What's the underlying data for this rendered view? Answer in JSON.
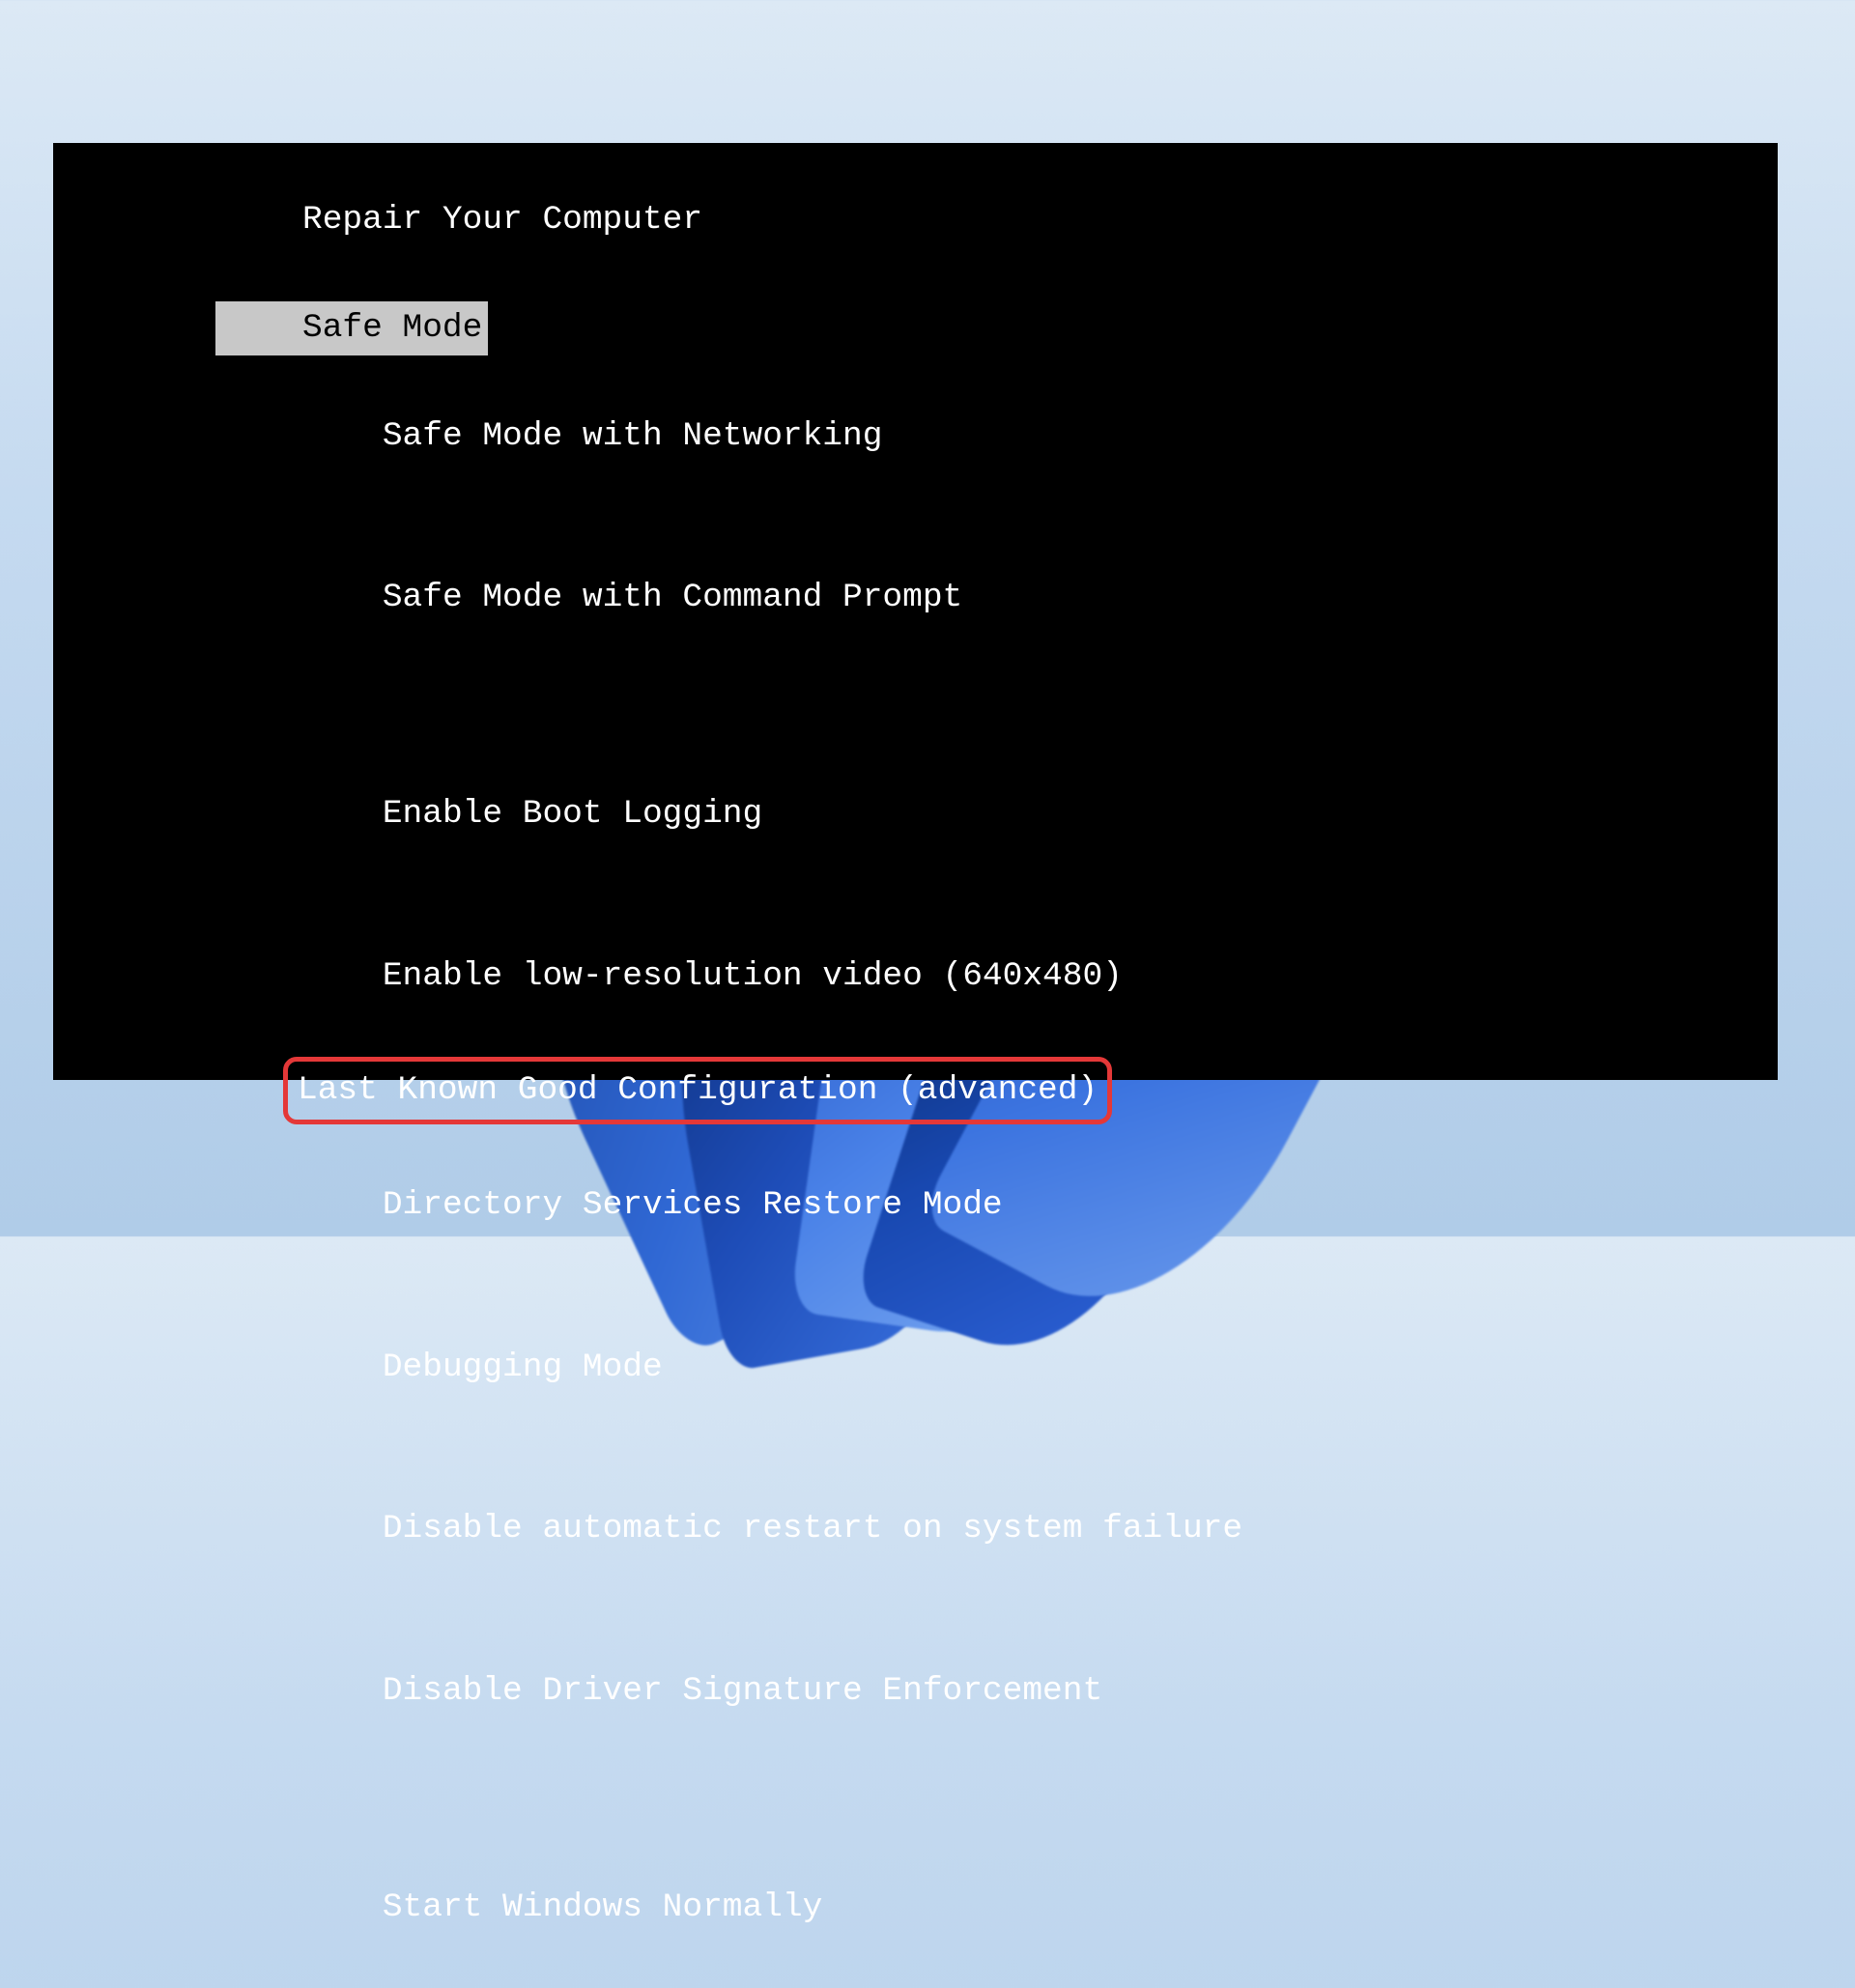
{
  "boot_menu": {
    "title": "Repair Your Computer",
    "groups": [
      {
        "items": [
          {
            "label": "Safe Mode",
            "selected": true,
            "highlighted": false
          },
          {
            "label": "Safe Mode with Networking",
            "selected": false,
            "highlighted": false
          },
          {
            "label": "Safe Mode with Command Prompt",
            "selected": false,
            "highlighted": false
          }
        ]
      },
      {
        "items": [
          {
            "label": "Enable Boot Logging",
            "selected": false,
            "highlighted": false
          },
          {
            "label": "Enable low-resolution video (640x480)",
            "selected": false,
            "highlighted": false
          },
          {
            "label": "Last Known Good Configuration (advanced)",
            "selected": false,
            "highlighted": true
          },
          {
            "label": "Directory Services Restore Mode",
            "selected": false,
            "highlighted": false
          },
          {
            "label": "Debugging Mode",
            "selected": false,
            "highlighted": false
          },
          {
            "label": "Disable automatic restart on system failure",
            "selected": false,
            "highlighted": false
          },
          {
            "label": "Disable Driver Signature Enforcement",
            "selected": false,
            "highlighted": false
          }
        ]
      },
      {
        "items": [
          {
            "label": "Start Windows Normally",
            "selected": false,
            "highlighted": false
          }
        ]
      }
    ]
  },
  "colors": {
    "selected_bg": "#c8c8c8",
    "selected_fg": "#000000",
    "highlight_border": "#e43838",
    "text": "#ffffff",
    "screen_bg": "#000000"
  }
}
